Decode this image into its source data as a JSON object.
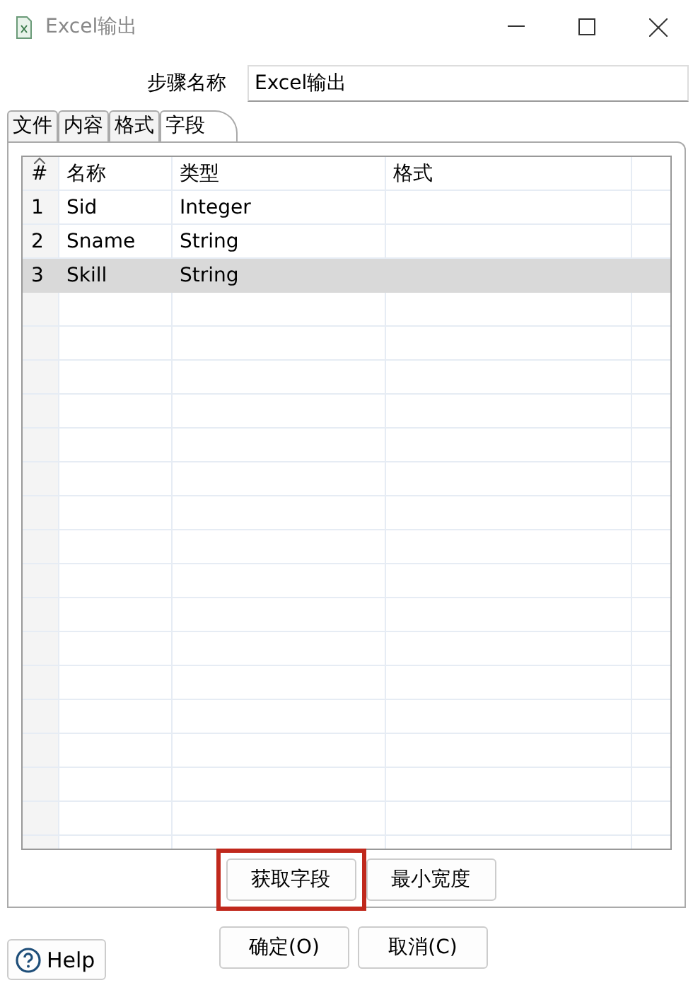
{
  "window": {
    "title": "Excel输出"
  },
  "step_name": {
    "label": "步骤名称",
    "value": "Excel输出"
  },
  "tabs": [
    {
      "label": "文件",
      "selected": false
    },
    {
      "label": "内容",
      "selected": false
    },
    {
      "label": "格式",
      "selected": false
    },
    {
      "label": "字段",
      "selected": true
    }
  ],
  "table": {
    "columns": [
      "#",
      "名称",
      "类型",
      "格式"
    ],
    "rows": [
      {
        "cells": [
          "1",
          "Sid",
          "Integer",
          ""
        ],
        "selected": false
      },
      {
        "cells": [
          "2",
          "Sname",
          "String",
          ""
        ],
        "selected": false
      },
      {
        "cells": [
          "3",
          "Skill",
          "String",
          ""
        ],
        "selected": true
      }
    ]
  },
  "table_buttons": [
    {
      "label": "获取字段",
      "highlighted": true
    },
    {
      "label": "最小宽度",
      "highlighted": false
    }
  ],
  "buttons": [
    "确定(O)",
    "取消(C)"
  ],
  "help": {
    "label": "Help"
  }
}
